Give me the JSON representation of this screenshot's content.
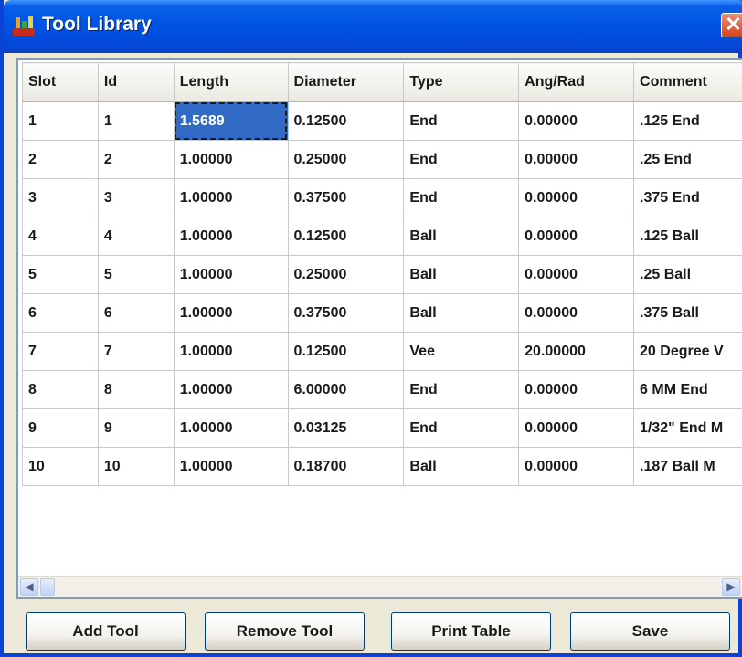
{
  "window": {
    "title": "Tool Library",
    "close_glyph": "✕",
    "icon": "tool-library-app-icon"
  },
  "table": {
    "columns": [
      "Slot",
      "Id",
      "Length",
      "Diameter",
      "Type",
      "Ang/Rad",
      "Comment"
    ],
    "rows": [
      [
        "1",
        "1",
        "1.5689",
        "0.12500",
        "End",
        "0.00000",
        ".125 End"
      ],
      [
        "2",
        "2",
        "1.00000",
        "0.25000",
        "End",
        "0.00000",
        ".25 End"
      ],
      [
        "3",
        "3",
        "1.00000",
        "0.37500",
        "End",
        "0.00000",
        ".375 End"
      ],
      [
        "4",
        "4",
        "1.00000",
        "0.12500",
        "Ball",
        "0.00000",
        ".125 Ball"
      ],
      [
        "5",
        "5",
        "1.00000",
        "0.25000",
        "Ball",
        "0.00000",
        ".25 Ball"
      ],
      [
        "6",
        "6",
        "1.00000",
        "0.37500",
        "Ball",
        "0.00000",
        ".375 Ball"
      ],
      [
        "7",
        "7",
        "1.00000",
        "0.12500",
        "Vee",
        "20.00000",
        "20 Degree V"
      ],
      [
        "8",
        "8",
        "1.00000",
        "6.00000",
        "End",
        "0.00000",
        "6 MM End"
      ],
      [
        "9",
        "9",
        "1.00000",
        "0.03125",
        "End",
        "0.00000",
        "1/32\" End M"
      ],
      [
        "10",
        "10",
        "1.00000",
        "0.18700",
        "Ball",
        "0.00000",
        ".187 Ball M"
      ]
    ],
    "selected_row": 0,
    "selected_col": 2
  },
  "scrollbar": {
    "left_glyph": "◀",
    "right_glyph": "▶"
  },
  "buttons": {
    "add": "Add Tool",
    "remove": "Remove Tool",
    "print": "Print Table",
    "save": "Save"
  }
}
